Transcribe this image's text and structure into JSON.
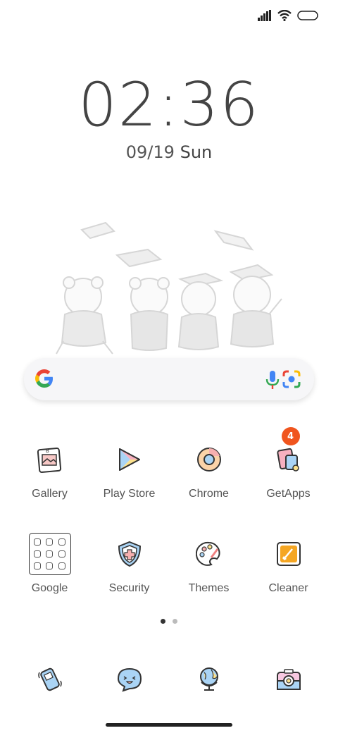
{
  "status_bar": {
    "icons": [
      "signal-icon",
      "wifi-icon",
      "battery-icon"
    ]
  },
  "clock": {
    "time": "02:36",
    "date": "09/19",
    "day": "Sun"
  },
  "search": {
    "icons": [
      "google-logo-icon",
      "microphone-icon",
      "camera-lens-icon"
    ]
  },
  "apps": [
    {
      "label": "Gallery",
      "icon": "gallery-icon"
    },
    {
      "label": "Play Store",
      "icon": "play-store-icon"
    },
    {
      "label": "Chrome",
      "icon": "chrome-icon"
    },
    {
      "label": "GetApps",
      "icon": "getapps-icon",
      "badge": "4"
    },
    {
      "label": "Google",
      "icon": "google-folder-icon"
    },
    {
      "label": "Security",
      "icon": "security-shield-icon"
    },
    {
      "label": "Themes",
      "icon": "themes-palette-icon"
    },
    {
      "label": "Cleaner",
      "icon": "cleaner-brush-icon"
    }
  ],
  "page_indicator": {
    "current": 1,
    "total": 2
  },
  "dock": [
    {
      "icon": "phone-icon"
    },
    {
      "icon": "messaging-icon"
    },
    {
      "icon": "browser-globe-icon"
    },
    {
      "icon": "camera-icon"
    }
  ],
  "colors": {
    "badge": "#f0551e",
    "search_bg": "#f6f6f8"
  }
}
